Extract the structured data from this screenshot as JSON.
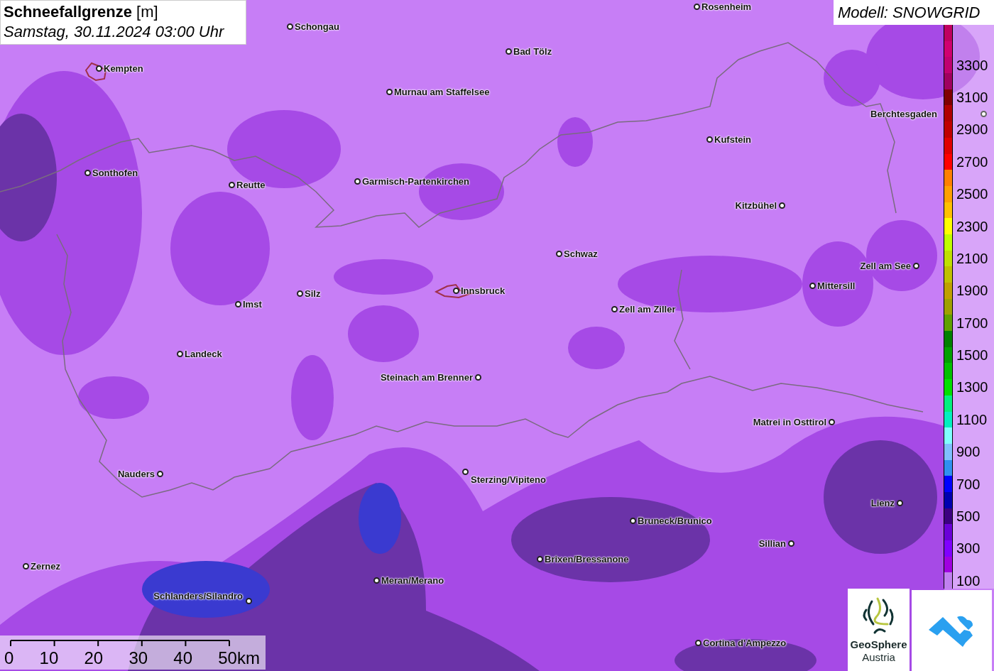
{
  "title": {
    "main": "Schneefallgrenze",
    "unit": "[m]",
    "time": "Samstag, 30.11.2024 03:00 Uhr"
  },
  "model": "Modell: SNOWGRID",
  "cities": [
    {
      "name": "Rosenheim"
    },
    {
      "name": "Schongau"
    },
    {
      "name": "Bad Tölz"
    },
    {
      "name": "Kempten"
    },
    {
      "name": "Murnau am Staffelsee"
    },
    {
      "name": "Berchtesgaden"
    },
    {
      "name": "Kufstein"
    },
    {
      "name": "Sonthofen"
    },
    {
      "name": "Reutte"
    },
    {
      "name": "Garmisch-Partenkirchen"
    },
    {
      "name": "Kitzbühel"
    },
    {
      "name": "Schwaz"
    },
    {
      "name": "Zell am See"
    },
    {
      "name": "Mittersill"
    },
    {
      "name": "Innsbruck"
    },
    {
      "name": "Silz"
    },
    {
      "name": "Imst"
    },
    {
      "name": "Zell am Ziller"
    },
    {
      "name": "Landeck"
    },
    {
      "name": "Steinach am Brenner"
    },
    {
      "name": "Matrei in Osttirol"
    },
    {
      "name": "Nauders"
    },
    {
      "name": "Sterzing/Vipiteno"
    },
    {
      "name": "Lienz"
    },
    {
      "name": "Bruneck/Brunico"
    },
    {
      "name": "Sillian"
    },
    {
      "name": "Brixen/Bressanone"
    },
    {
      "name": "Zernez"
    },
    {
      "name": "Meran/Merano"
    },
    {
      "name": "Schlanders/Silandro"
    },
    {
      "name": "Cortina d'Ampezzo"
    }
  ],
  "legend": {
    "items": [
      {
        "color": "#c00060"
      },
      {
        "color": "#d00070"
      },
      {
        "color": "#c00070",
        "label": "3300"
      },
      {
        "color": "#a00060"
      },
      {
        "color": "#800000",
        "label": "3100"
      },
      {
        "color": "#b00000"
      },
      {
        "color": "#c00000",
        "label": "2900"
      },
      {
        "color": "#e00000"
      },
      {
        "color": "#ff0000",
        "label": "2700"
      },
      {
        "color": "#ff8000"
      },
      {
        "color": "#ffa000",
        "label": "2500"
      },
      {
        "color": "#ffc000"
      },
      {
        "color": "#ffff00",
        "label": "2300"
      },
      {
        "color": "#c0ff00"
      },
      {
        "color": "#c0e000",
        "label": "2100"
      },
      {
        "color": "#c0c000"
      },
      {
        "color": "#c0a000",
        "label": "1900"
      },
      {
        "color": "#a0a000"
      },
      {
        "color": "#60a000",
        "label": "1700"
      },
      {
        "color": "#008000"
      },
      {
        "color": "#00a000",
        "label": "1500"
      },
      {
        "color": "#00c000"
      },
      {
        "color": "#00e000",
        "label": "1300"
      },
      {
        "color": "#00f080"
      },
      {
        "color": "#00f0c0",
        "label": "1100"
      },
      {
        "color": "#80ffff"
      },
      {
        "color": "#80c0ff",
        "label": "900"
      },
      {
        "color": "#3090f0"
      },
      {
        "color": "#0000ff",
        "label": "700"
      },
      {
        "color": "#0000b0"
      },
      {
        "color": "#3c0080",
        "label": "500"
      },
      {
        "color": "#6a00d8"
      },
      {
        "color": "#8000ff",
        "label": "300"
      },
      {
        "color": "#a000e0"
      },
      {
        "color": "#c080f0",
        "label": "100"
      }
    ]
  },
  "scale": {
    "ticks": [
      "0",
      "10",
      "20",
      "30",
      "40",
      "50km"
    ]
  },
  "logos": {
    "geosphere_line1": "GeoSphere",
    "geosphere_line2": "Austria"
  }
}
